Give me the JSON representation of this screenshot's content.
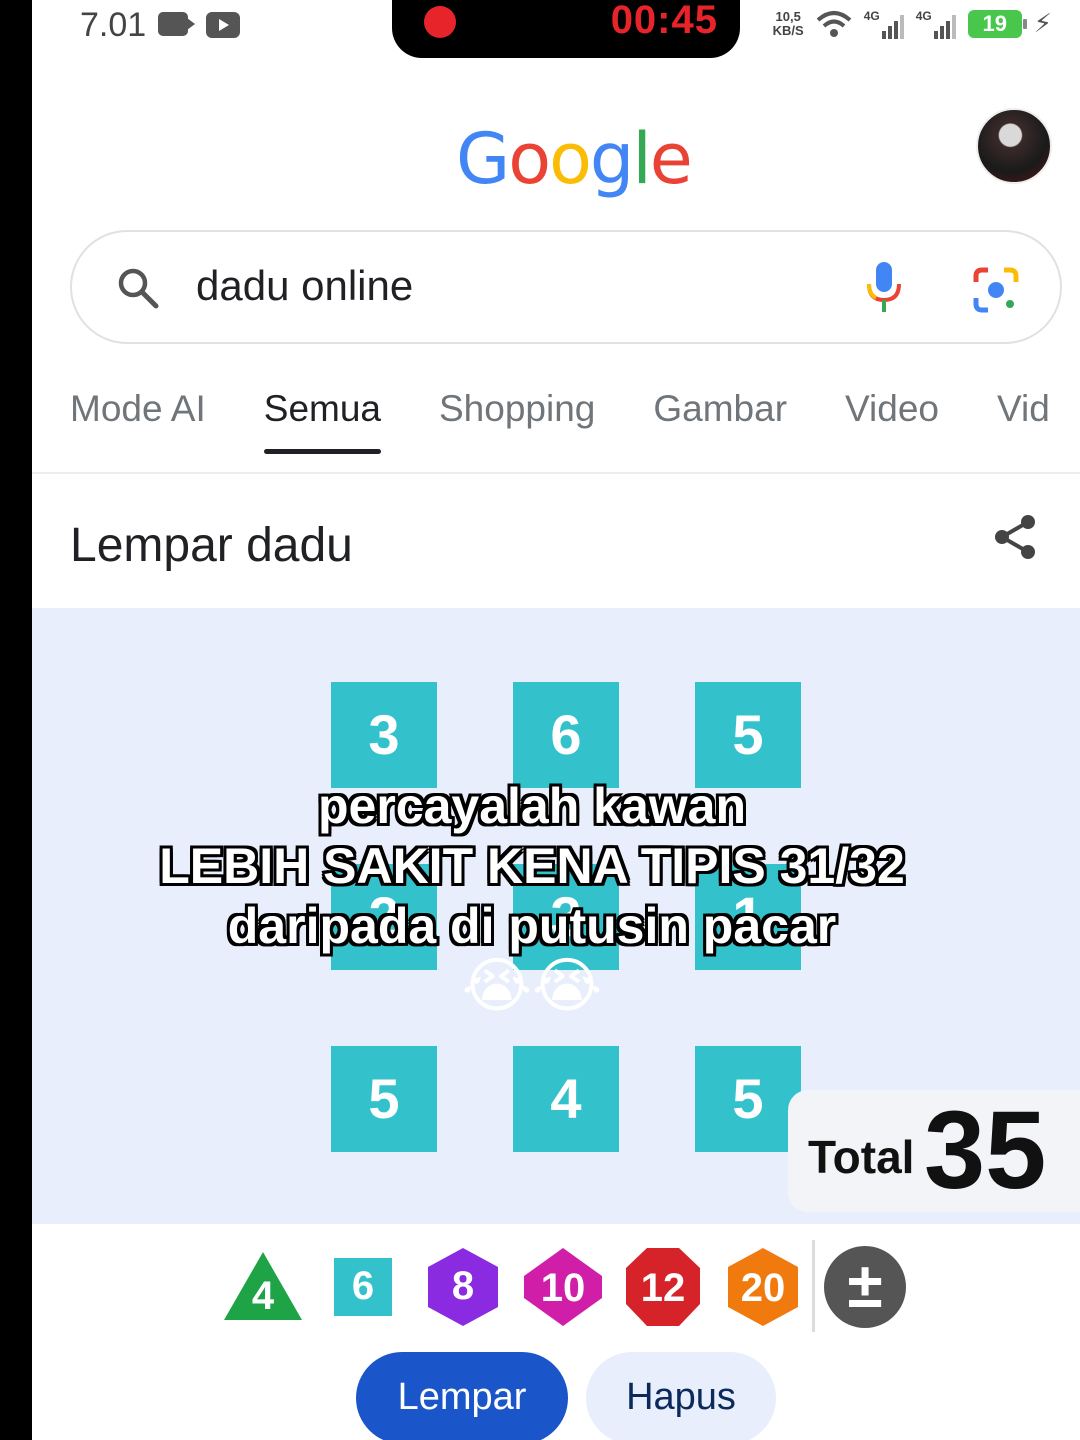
{
  "status_bar": {
    "time": "7.01",
    "recording_timer": "00:45",
    "net_speed_value": "10,5",
    "net_speed_unit": "KB/S",
    "signal_1": "4G",
    "signal_2": "4G",
    "battery": "19",
    "recording_color": "#e8242b",
    "battery_color": "#49c64c"
  },
  "header": {
    "logo_letters": [
      "G",
      "o",
      "o",
      "g",
      "l",
      "e"
    ]
  },
  "search": {
    "query": "dadu online"
  },
  "tabs": [
    {
      "label": "Mode AI",
      "active": false
    },
    {
      "label": "Semua",
      "active": true
    },
    {
      "label": "Shopping",
      "active": false
    },
    {
      "label": "Gambar",
      "active": false
    },
    {
      "label": "Video",
      "active": false
    },
    {
      "label": "Vid",
      "active": false
    }
  ],
  "card": {
    "title": "Lempar dadu",
    "dice_color": "#33c2cc",
    "dice_rows": [
      [
        "3",
        "6",
        "5"
      ],
      [
        "2",
        "3",
        "1"
      ],
      [
        "5",
        "4",
        "5"
      ]
    ],
    "total_label": "Total",
    "total_value": "35"
  },
  "caption": {
    "line1": "percayalah kawan",
    "line2": "LEBIH SAKIT KENA TIPIS 31/32",
    "line3": "daripada di putusin pacar",
    "line4": "😭😭"
  },
  "dice_selector": [
    {
      "label": "4",
      "color": "#1ea446",
      "shape": "triangle"
    },
    {
      "label": "6",
      "color": "#33c2cc",
      "shape": "square"
    },
    {
      "label": "8",
      "color": "#8a2be2",
      "shape": "hexagon"
    },
    {
      "label": "10",
      "color": "#d01ea8",
      "shape": "diamond"
    },
    {
      "label": "12",
      "color": "#d6232a",
      "shape": "octagon"
    },
    {
      "label": "20",
      "color": "#f07a0e",
      "shape": "hexagon"
    }
  ],
  "add_die_label": "±",
  "buttons": {
    "roll": "Lempar",
    "clear": "Hapus",
    "roll_color": "#1a56c9"
  }
}
